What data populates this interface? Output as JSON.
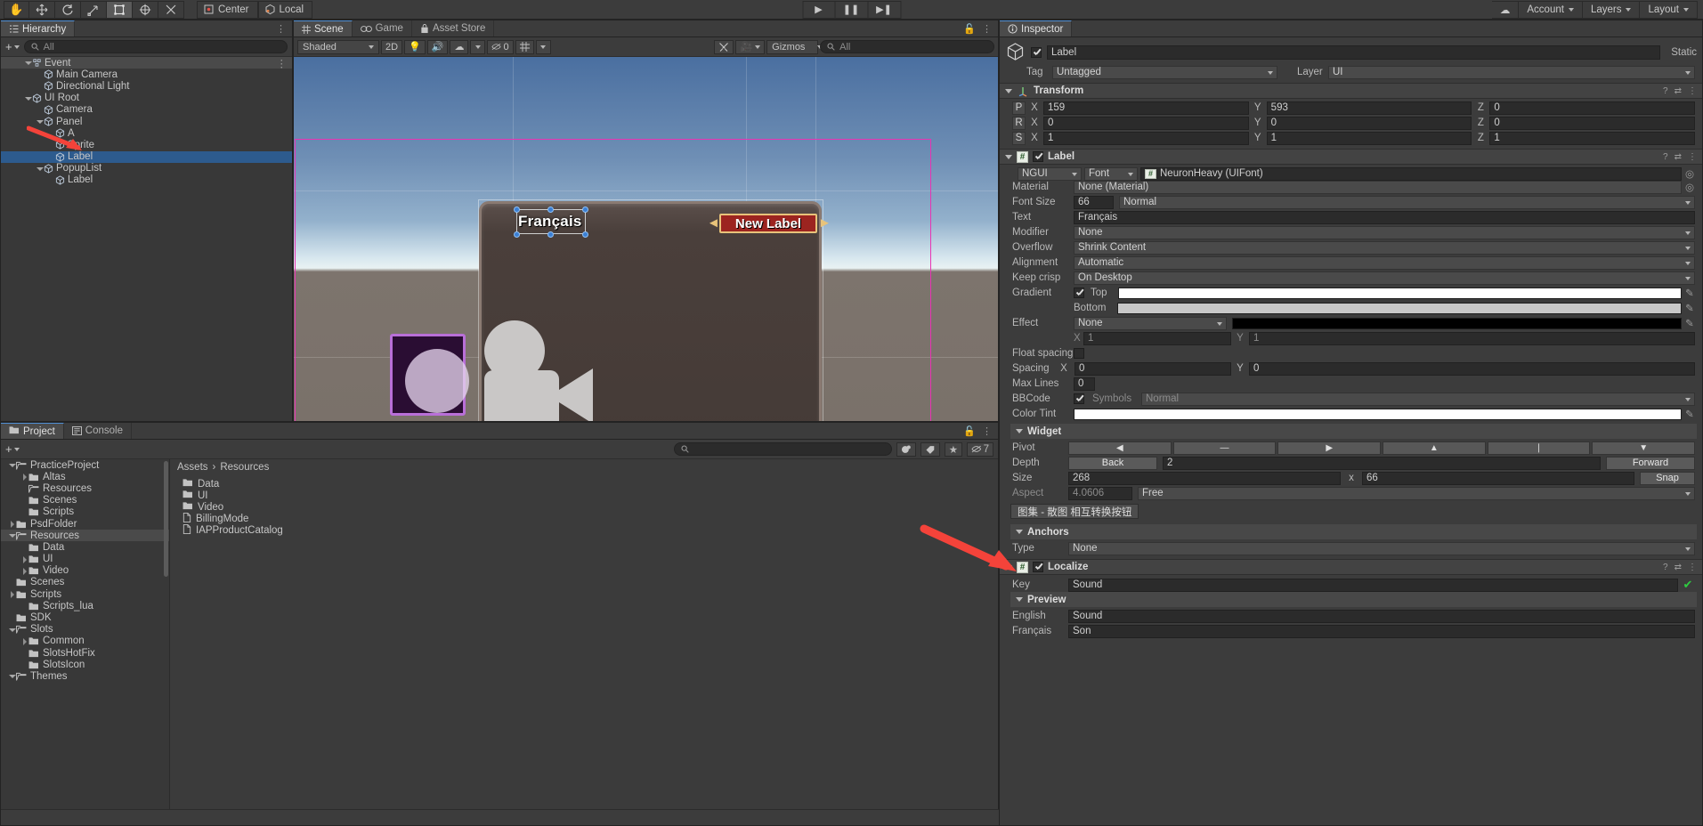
{
  "toolbar": {
    "tools": [
      "hand-tool",
      "move-tool",
      "rotate-tool",
      "scale-tool",
      "rect-tool",
      "transform-tool",
      "custom-tool"
    ],
    "pivot_mode": "Center",
    "pivot_rotation": "Local",
    "play": "▶",
    "pause": "❘❘",
    "step": "▶❘",
    "cloud_label": "",
    "account": "Account",
    "layers": "Layers",
    "layout": "Layout"
  },
  "hierarchy": {
    "tab": "Hierarchy",
    "search_placeholder": "All",
    "items": [
      {
        "label": "Event",
        "depth": 1,
        "arrow": "down",
        "selected": false,
        "header": true
      },
      {
        "label": "Main Camera",
        "depth": 2,
        "arrow": "none",
        "selected": false
      },
      {
        "label": "Directional Light",
        "depth": 2,
        "arrow": "none",
        "selected": false
      },
      {
        "label": "UI Root",
        "depth": 1,
        "arrow": "down",
        "selected": false
      },
      {
        "label": "Camera",
        "depth": 2,
        "arrow": "none",
        "selected": false
      },
      {
        "label": "Panel",
        "depth": 2,
        "arrow": "down",
        "selected": false
      },
      {
        "label": "A",
        "depth": 3,
        "arrow": "none",
        "selected": false
      },
      {
        "label": "Sprite",
        "depth": 3,
        "arrow": "none",
        "selected": false
      },
      {
        "label": "Label",
        "depth": 3,
        "arrow": "none",
        "selected": true
      },
      {
        "label": "PopupList",
        "depth": 2,
        "arrow": "down",
        "selected": false
      },
      {
        "label": "Label",
        "depth": 3,
        "arrow": "none",
        "selected": false
      }
    ]
  },
  "scene": {
    "tabs": [
      {
        "label": "Scene",
        "icon": "grid-icon",
        "selected": true
      },
      {
        "label": "Game",
        "icon": "gamepad-icon",
        "selected": false
      },
      {
        "label": "Asset Store",
        "icon": "store-icon",
        "selected": false
      }
    ],
    "draw_mode": "Shaded",
    "two_d": "2D",
    "hidden_count": "0",
    "gizmos": "Gizmos",
    "gizmo_search_placeholder": "All",
    "label_francais": "Français",
    "label_newlabel": "New Label"
  },
  "project": {
    "tabs": [
      {
        "label": "Project",
        "icon": "folder-icon",
        "selected": true
      },
      {
        "label": "Console",
        "icon": "console-icon",
        "selected": false
      }
    ],
    "search_placeholder": "",
    "filter_icons": [
      "sphere-filter-icon",
      "label-filter-icon",
      "star-filter-icon",
      "hidden-filter-icon"
    ],
    "hidden_count": "7",
    "tree": [
      {
        "label": "PracticeProject",
        "depth": 1,
        "arrow": "down",
        "open": true
      },
      {
        "label": "Altas",
        "depth": 2,
        "arrow": "right",
        "open": false
      },
      {
        "label": "Resources",
        "depth": 2,
        "arrow": "none",
        "open": true
      },
      {
        "label": "Scenes",
        "depth": 2,
        "arrow": "none",
        "open": false
      },
      {
        "label": "Scripts",
        "depth": 2,
        "arrow": "none",
        "open": false
      },
      {
        "label": "PsdFolder",
        "depth": 1,
        "arrow": "right",
        "open": false
      },
      {
        "label": "Resources",
        "depth": 1,
        "arrow": "down",
        "open": true,
        "selected": true
      },
      {
        "label": "Data",
        "depth": 2,
        "arrow": "none",
        "open": false
      },
      {
        "label": "UI",
        "depth": 2,
        "arrow": "right",
        "open": false
      },
      {
        "label": "Video",
        "depth": 2,
        "arrow": "right",
        "open": false
      },
      {
        "label": "Scenes",
        "depth": 1,
        "arrow": "none",
        "open": false
      },
      {
        "label": "Scripts",
        "depth": 1,
        "arrow": "right",
        "open": false
      },
      {
        "label": "Scripts_lua",
        "depth": 2,
        "arrow": "none",
        "open": false
      },
      {
        "label": "SDK",
        "depth": 1,
        "arrow": "none",
        "open": false
      },
      {
        "label": "Slots",
        "depth": 1,
        "arrow": "down",
        "open": true
      },
      {
        "label": "Common",
        "depth": 2,
        "arrow": "right",
        "open": false
      },
      {
        "label": "SlotsHotFix",
        "depth": 2,
        "arrow": "none",
        "open": false
      },
      {
        "label": "SlotsIcon",
        "depth": 2,
        "arrow": "none",
        "open": false
      },
      {
        "label": "Themes",
        "depth": 1,
        "arrow": "down",
        "open": true
      }
    ],
    "breadcrumb": [
      "Assets",
      "Resources"
    ],
    "assets": [
      {
        "label": "Data",
        "type": "folder"
      },
      {
        "label": "UI",
        "type": "folder"
      },
      {
        "label": "Video",
        "type": "folder"
      },
      {
        "label": "BillingMode",
        "type": "file"
      },
      {
        "label": "IAPProductCatalog",
        "type": "file"
      }
    ]
  },
  "inspector": {
    "tab": "Inspector",
    "object_name": "Label",
    "object_enabled": true,
    "static_label": "Static",
    "tag_label": "Tag",
    "tag_value": "Untagged",
    "layer_label": "Layer",
    "layer_value": "UI",
    "transform": {
      "title": "Transform",
      "rows": [
        {
          "prefix": "P",
          "x_label": "X",
          "x": "159",
          "y_label": "Y",
          "y": "593",
          "z_label": "Z",
          "z": "0"
        },
        {
          "prefix": "R",
          "x_label": "X",
          "x": "0",
          "y_label": "Y",
          "y": "0",
          "z_label": "Z",
          "z": "0"
        },
        {
          "prefix": "S",
          "x_label": "X",
          "x": "1",
          "y_label": "Y",
          "y": "1",
          "z_label": "Z",
          "z": "1"
        }
      ]
    },
    "label_component": {
      "title": "Label",
      "enabled": true,
      "font_source": "NGUI",
      "font_type": "Font",
      "font_asset": "NeuronHeavy (UIFont)",
      "material_label": "Material",
      "material_value": "None (Material)",
      "font_size_label": "Font Size",
      "font_size_value": "66",
      "font_style_value": "Normal",
      "text_label": "Text",
      "text_value": "Français",
      "modifier_label": "Modifier",
      "modifier_value": "None",
      "overflow_label": "Overflow",
      "overflow_value": "Shrink Content",
      "alignment_label": "Alignment",
      "alignment_value": "Automatic",
      "keep_crisp_label": "Keep crisp",
      "keep_crisp_value": "On Desktop",
      "gradient_label": "Gradient",
      "gradient_checked": true,
      "gradient_top_label": "Top",
      "gradient_top_color": "#ffffff",
      "gradient_bottom_label": "Bottom",
      "gradient_bottom_color": "#c8c8c8",
      "effect_label": "Effect",
      "effect_value": "None",
      "effect_color": "#000000",
      "effect_x_label": "X",
      "effect_x_value": "1",
      "effect_y_label": "Y",
      "effect_y_value": "1",
      "float_spacing_label": "Float spacing",
      "float_spacing_checked": false,
      "spacing_label": "Spacing",
      "spacing_x_label": "X",
      "spacing_x_value": "0",
      "spacing_y_label": "Y",
      "spacing_y_value": "0",
      "max_lines_label": "Max Lines",
      "max_lines_value": "0",
      "bbcode_label": "BBCode",
      "bbcode_checked": true,
      "symbols_label": "Symbols",
      "symbols_value": "Normal",
      "color_tint_label": "Color Tint",
      "color_tint_color": "#ffffff"
    },
    "widget": {
      "title": "Widget",
      "pivot_label": "Pivot",
      "pivot_buttons": [
        "◀",
        "—",
        "▶",
        "▲",
        "❘",
        "▼"
      ],
      "depth_label": "Depth",
      "depth_back": "Back",
      "depth_value": "2",
      "depth_forward": "Forward",
      "size_label": "Size",
      "size_w": "268",
      "size_x_sep": "x",
      "size_h": "66",
      "snap_label": "Snap",
      "aspect_label": "Aspect",
      "aspect_value": "4.0606",
      "aspect_mode": "Free",
      "atlas_button": "图集 - 散图 相互转换按钮"
    },
    "anchors": {
      "title": "Anchors",
      "type_label": "Type",
      "type_value": "None"
    },
    "localize": {
      "title": "Localize",
      "enabled": true,
      "key_label": "Key",
      "key_value": "Sound",
      "preview_title": "Preview",
      "rows": [
        {
          "lang": "English",
          "value": "Sound"
        },
        {
          "lang": "Français",
          "value": "Son"
        }
      ]
    }
  },
  "annotations": {
    "arrow_color": "#f4433a",
    "arrows": [
      "hierarchy-label-arrow",
      "localize-component-arrow"
    ]
  }
}
